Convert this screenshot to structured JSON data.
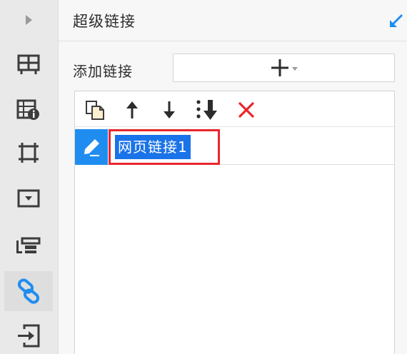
{
  "panel": {
    "title": "超级链接",
    "add_label": "添加链接"
  },
  "toolbar": {
    "items": [
      "copy-icon",
      "move-up-icon",
      "move-down-icon",
      "move-to-bottom-icon",
      "delete-icon"
    ]
  },
  "links": [
    {
      "name": "网页链接1",
      "selected": true
    }
  ],
  "colors": {
    "accent": "#1f8df0",
    "selection": "#1a73e8",
    "delete": "#e8262c",
    "highlight_border": "#e8262c"
  }
}
